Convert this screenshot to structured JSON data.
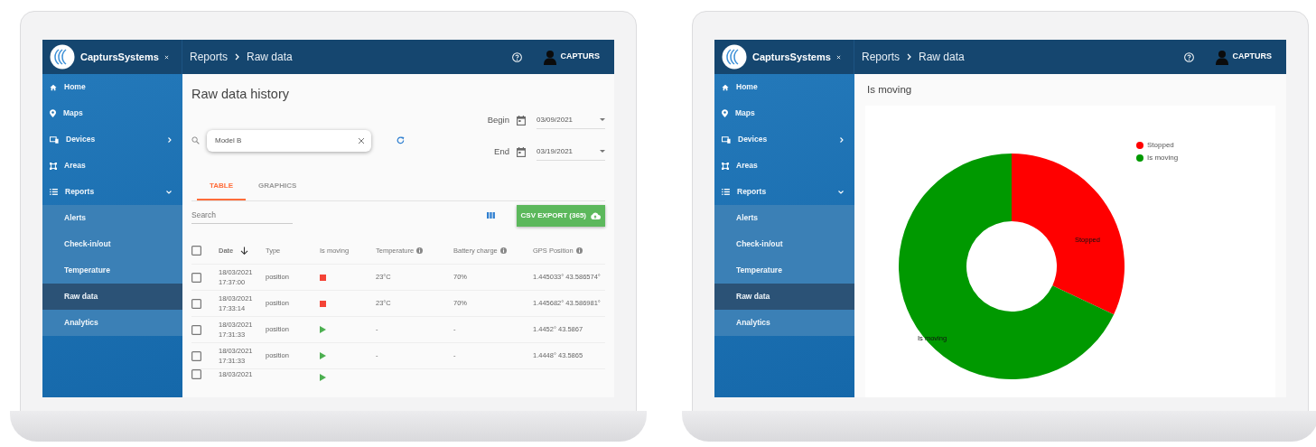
{
  "screens": [
    {
      "kind": "table",
      "brand": "CaptursSystems",
      "breadcrumb": [
        "Reports",
        "Raw data"
      ],
      "user": "CAPTURS",
      "sidebar": [
        {
          "label": "Home",
          "selected": false
        },
        {
          "label": "Maps",
          "selected": false
        },
        {
          "label": "Devices",
          "selected": false,
          "expanded": false
        },
        {
          "label": "Areas",
          "selected": false
        },
        {
          "label": "Reports",
          "selected": false,
          "expanded": true,
          "children": [
            {
              "label": "Alerts",
              "selected": false
            },
            {
              "label": "Check-in/out",
              "selected": false
            },
            {
              "label": "Temperature",
              "selected": false
            },
            {
              "label": "Raw data",
              "selected": true
            },
            {
              "label": "Analytics",
              "selected": false
            }
          ]
        }
      ],
      "title": "Raw data history",
      "search": {
        "value": "Model B"
      },
      "dates": [
        {
          "label": "Begin",
          "value": "03/09/2021"
        },
        {
          "label": "End",
          "value": "03/19/2021"
        }
      ],
      "tabs": [
        {
          "label": "TABLE",
          "selected": true
        },
        {
          "label": "GRAPHICS",
          "selected": false
        }
      ],
      "table_search": {
        "placeholder": "Search"
      },
      "export_button": "CSV EXPORT (365)",
      "table": {
        "columns": [
          {
            "label": "Date",
            "sorted": true,
            "info": false
          },
          {
            "label": "Type",
            "sorted": false,
            "info": false
          },
          {
            "label": "Is moving",
            "sorted": false,
            "info": false
          },
          {
            "label": "Temperature",
            "sorted": false,
            "info": true
          },
          {
            "label": "Battery charge",
            "sorted": false,
            "info": true
          },
          {
            "label": "GPS Position",
            "sorted": false,
            "info": true
          }
        ],
        "rows": [
          {
            "checked": false,
            "cells": [
              "18/03/2021 17:37:00",
              "position",
              "",
              "23°C",
              "70%",
              "1.445033° 43.586574°"
            ],
            "moving": false
          },
          {
            "checked": false,
            "cells": [
              "18/03/2021 17:33:14",
              "position",
              "",
              "23°C",
              "70%",
              "1.445682° 43.586981°"
            ],
            "moving": false
          },
          {
            "checked": false,
            "cells": [
              "18/03/2021 17:31:33",
              "position",
              "",
              "-",
              "-",
              "1.4452° 43.5867"
            ],
            "moving": true
          },
          {
            "checked": false,
            "cells": [
              "18/03/2021 17:31:33",
              "position",
              "",
              "-",
              "-",
              "1.4448° 43.5865"
            ],
            "moving": true
          },
          {
            "checked": false,
            "cells": [
              "18/03/2021"
            ],
            "moving": true
          }
        ]
      }
    },
    {
      "kind": "chart",
      "brand": "CaptursSystems",
      "breadcrumb": [
        "Reports",
        "Raw data"
      ],
      "user": "CAPTURS",
      "sidebar": [
        {
          "label": "Home",
          "selected": false
        },
        {
          "label": "Maps",
          "selected": false
        },
        {
          "label": "Devices",
          "selected": false,
          "expanded": false
        },
        {
          "label": "Areas",
          "selected": false
        },
        {
          "label": "Reports",
          "selected": false,
          "expanded": true,
          "children": [
            {
              "label": "Alerts",
              "selected": false
            },
            {
              "label": "Check-in/out",
              "selected": false
            },
            {
              "label": "Temperature",
              "selected": false
            },
            {
              "label": "Raw data",
              "selected": true
            },
            {
              "label": "Analytics",
              "selected": false
            }
          ]
        }
      ],
      "title": "Is moving",
      "slices": [
        {
          "label": "Stopped",
          "color": "#ff0000"
        },
        {
          "label": "Is moving",
          "color": "#009900"
        }
      ],
      "legend": [
        {
          "label": "Stopped",
          "color": "#ff0000"
        },
        {
          "label": "Is moving",
          "color": "#009900"
        }
      ]
    }
  ]
}
